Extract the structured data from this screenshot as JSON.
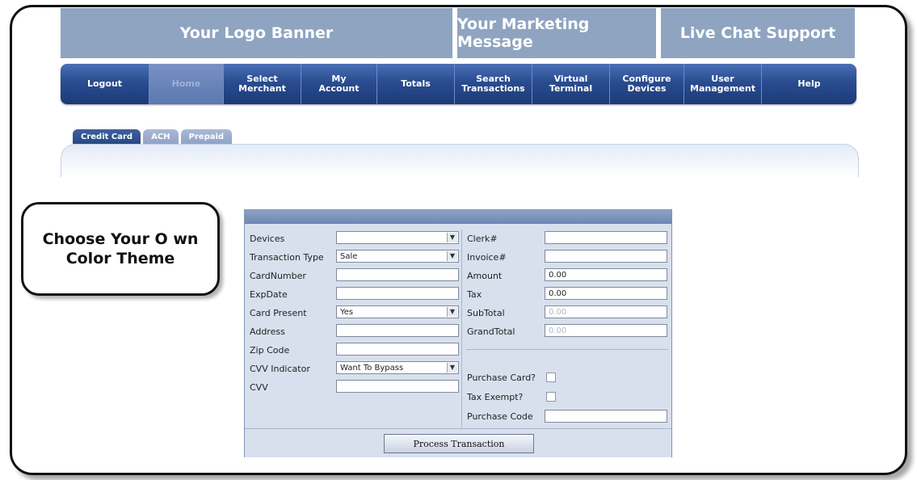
{
  "banners": {
    "logo": "Your Logo Banner",
    "marketing": "Your Marketing Message",
    "chat": "Live Chat Support"
  },
  "nav": [
    {
      "label": "Logout"
    },
    {
      "label": "Home"
    },
    {
      "label": "Select\nMerchant"
    },
    {
      "label": "My\nAccount"
    },
    {
      "label": "Totals"
    },
    {
      "label": "Search\nTransactions"
    },
    {
      "label": "Virtual\nTerminal"
    },
    {
      "label": "Configure\nDevices"
    },
    {
      "label": "User\nManagement"
    },
    {
      "label": "Help"
    }
  ],
  "tabs": [
    {
      "label": "Credit Card"
    },
    {
      "label": "ACH"
    },
    {
      "label": "Prepaid"
    }
  ],
  "callout": {
    "line1": "Choose Your O wn",
    "line2": "Color Theme"
  },
  "form": {
    "left": {
      "devices": {
        "label": "Devices",
        "value": ""
      },
      "transaction_type": {
        "label": "Transaction Type",
        "value": "Sale"
      },
      "card_number": {
        "label": "CardNumber",
        "value": ""
      },
      "exp_date": {
        "label": "ExpDate",
        "value": ""
      },
      "card_present": {
        "label": "Card Present",
        "value": "Yes"
      },
      "address": {
        "label": "Address",
        "value": ""
      },
      "zip_code": {
        "label": "Zip Code",
        "value": ""
      },
      "cvv_indicator": {
        "label": "CVV Indicator",
        "value": "Want To Bypass"
      },
      "cvv": {
        "label": "CVV",
        "value": ""
      }
    },
    "right": {
      "clerk": {
        "label": "Clerk#",
        "value": ""
      },
      "invoice": {
        "label": "Invoice#",
        "value": ""
      },
      "amount": {
        "label": "Amount",
        "value": "0.00"
      },
      "tax": {
        "label": "Tax",
        "value": "0.00"
      },
      "subtotal": {
        "label": "SubTotal",
        "value": "0.00"
      },
      "grandtotal": {
        "label": "GrandTotal",
        "value": "0.00"
      },
      "purchase_card": {
        "label": "Purchase Card?"
      },
      "tax_exempt": {
        "label": "Tax Exempt?"
      },
      "purchase_code": {
        "label": "Purchase Code",
        "value": ""
      }
    },
    "submit_label": "Process Transaction"
  }
}
